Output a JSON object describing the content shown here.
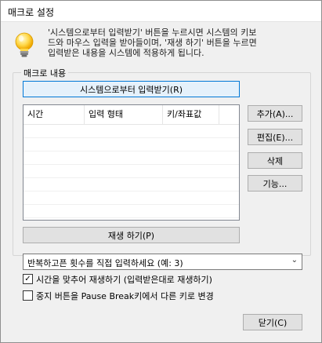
{
  "window": {
    "title": "매크로 설정"
  },
  "info": {
    "icon": "lightbulb-icon",
    "lines": [
      "'시스템으로부터 입력받기' 버튼을 누르시면 시스템의 키보",
      "드와 마우스 입력을 받아들이며, '재생 하기' 버튼을 누르면",
      "입력받은 내용을 시스템에 적용하게 됩니다."
    ]
  },
  "group": {
    "label": "매크로 내용",
    "record_button": "시스템으로부터 입력받기(R)",
    "play_button": "재생 하기(P)"
  },
  "list": {
    "columns": [
      "시간",
      "입력 형태",
      "키/좌표값"
    ],
    "rows": []
  },
  "side_buttons": {
    "add": "추가(A)...",
    "edit": "편집(E)...",
    "delete": "삭제",
    "function": "기능..."
  },
  "repeat_combo": {
    "value": "반복하고픈 횟수를 직접 입력하세요 (예: 3)"
  },
  "checkboxes": {
    "sync_time": {
      "label": "시간을 맞추어 재생하기 (입력받은대로 재생하기)",
      "checked": true
    },
    "stop_key": {
      "label": "중지 버튼을 Pause Break키에서 다른 키로 변경",
      "checked": false
    }
  },
  "close_button": "닫기(C)"
}
